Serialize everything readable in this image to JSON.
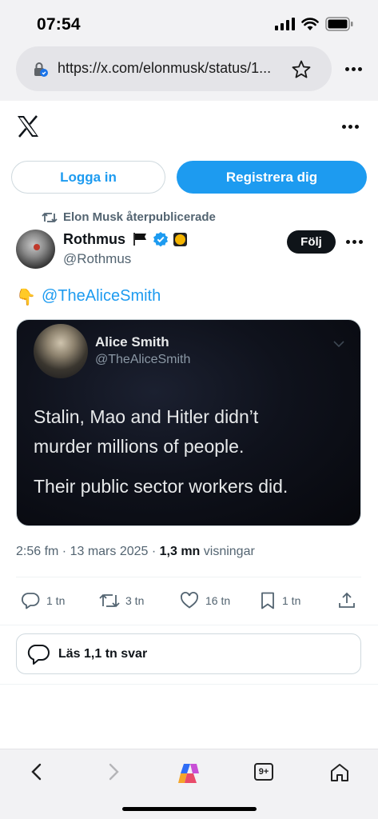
{
  "status_bar": {
    "time": "07:54"
  },
  "browser": {
    "url": "https://x.com/elonmusk/status/1...",
    "icons": [
      "lock-icon",
      "star-icon",
      "more-icon"
    ]
  },
  "header": {
    "login_label": "Logga in",
    "signup_label": "Registrera dig"
  },
  "tweet": {
    "repost_label": "Elon Musk återpublicerade",
    "author_name": "Rothmus",
    "author_handle": "@Rothmus",
    "follow_label": "Följ",
    "mention": "@TheAliceSmith",
    "emoji": "👇"
  },
  "quoted_image": {
    "name": "Alice Smith",
    "handle": "@TheAliceSmith",
    "line1": "Stalin, Mao and Hitler didn’t",
    "line2": "murder millions of people.",
    "line3": "Their public sector workers did."
  },
  "meta": {
    "timestamp": "2:56 fm · 13 mars 2025 · ",
    "views_count": "1,3 mn",
    "views_label": " visningar"
  },
  "actions": {
    "replies": "1 tn",
    "reposts": "3 tn",
    "likes": "16 tn",
    "bookmarks": "1 tn"
  },
  "read_replies_label": "Läs 1,1 tn svar",
  "bottom_nav": {
    "tabs_count": "9+"
  },
  "colors": {
    "accent": "#1d9bf0",
    "text_primary": "#0f1419",
    "text_secondary": "#536471"
  }
}
